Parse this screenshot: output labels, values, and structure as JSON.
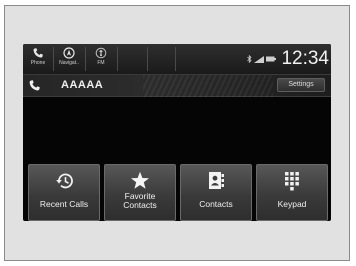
{
  "status_bar": {
    "phone_label": "Phone",
    "navigation_label": "Navigat..",
    "fm_label": "FM",
    "clock": "12:34"
  },
  "call": {
    "caller_name": "AAAAA",
    "settings_label": "Settings"
  },
  "tiles": [
    {
      "label": "Recent Calls",
      "icon": "history-icon"
    },
    {
      "label": "Favorite\nContacts",
      "icon": "star-icon"
    },
    {
      "label": "Contacts",
      "icon": "contacts-book-icon"
    },
    {
      "label": "Keypad",
      "icon": "keypad-icon"
    }
  ],
  "tile_favorite_line1": "Favorite",
  "tile_favorite_line2": "Contacts"
}
